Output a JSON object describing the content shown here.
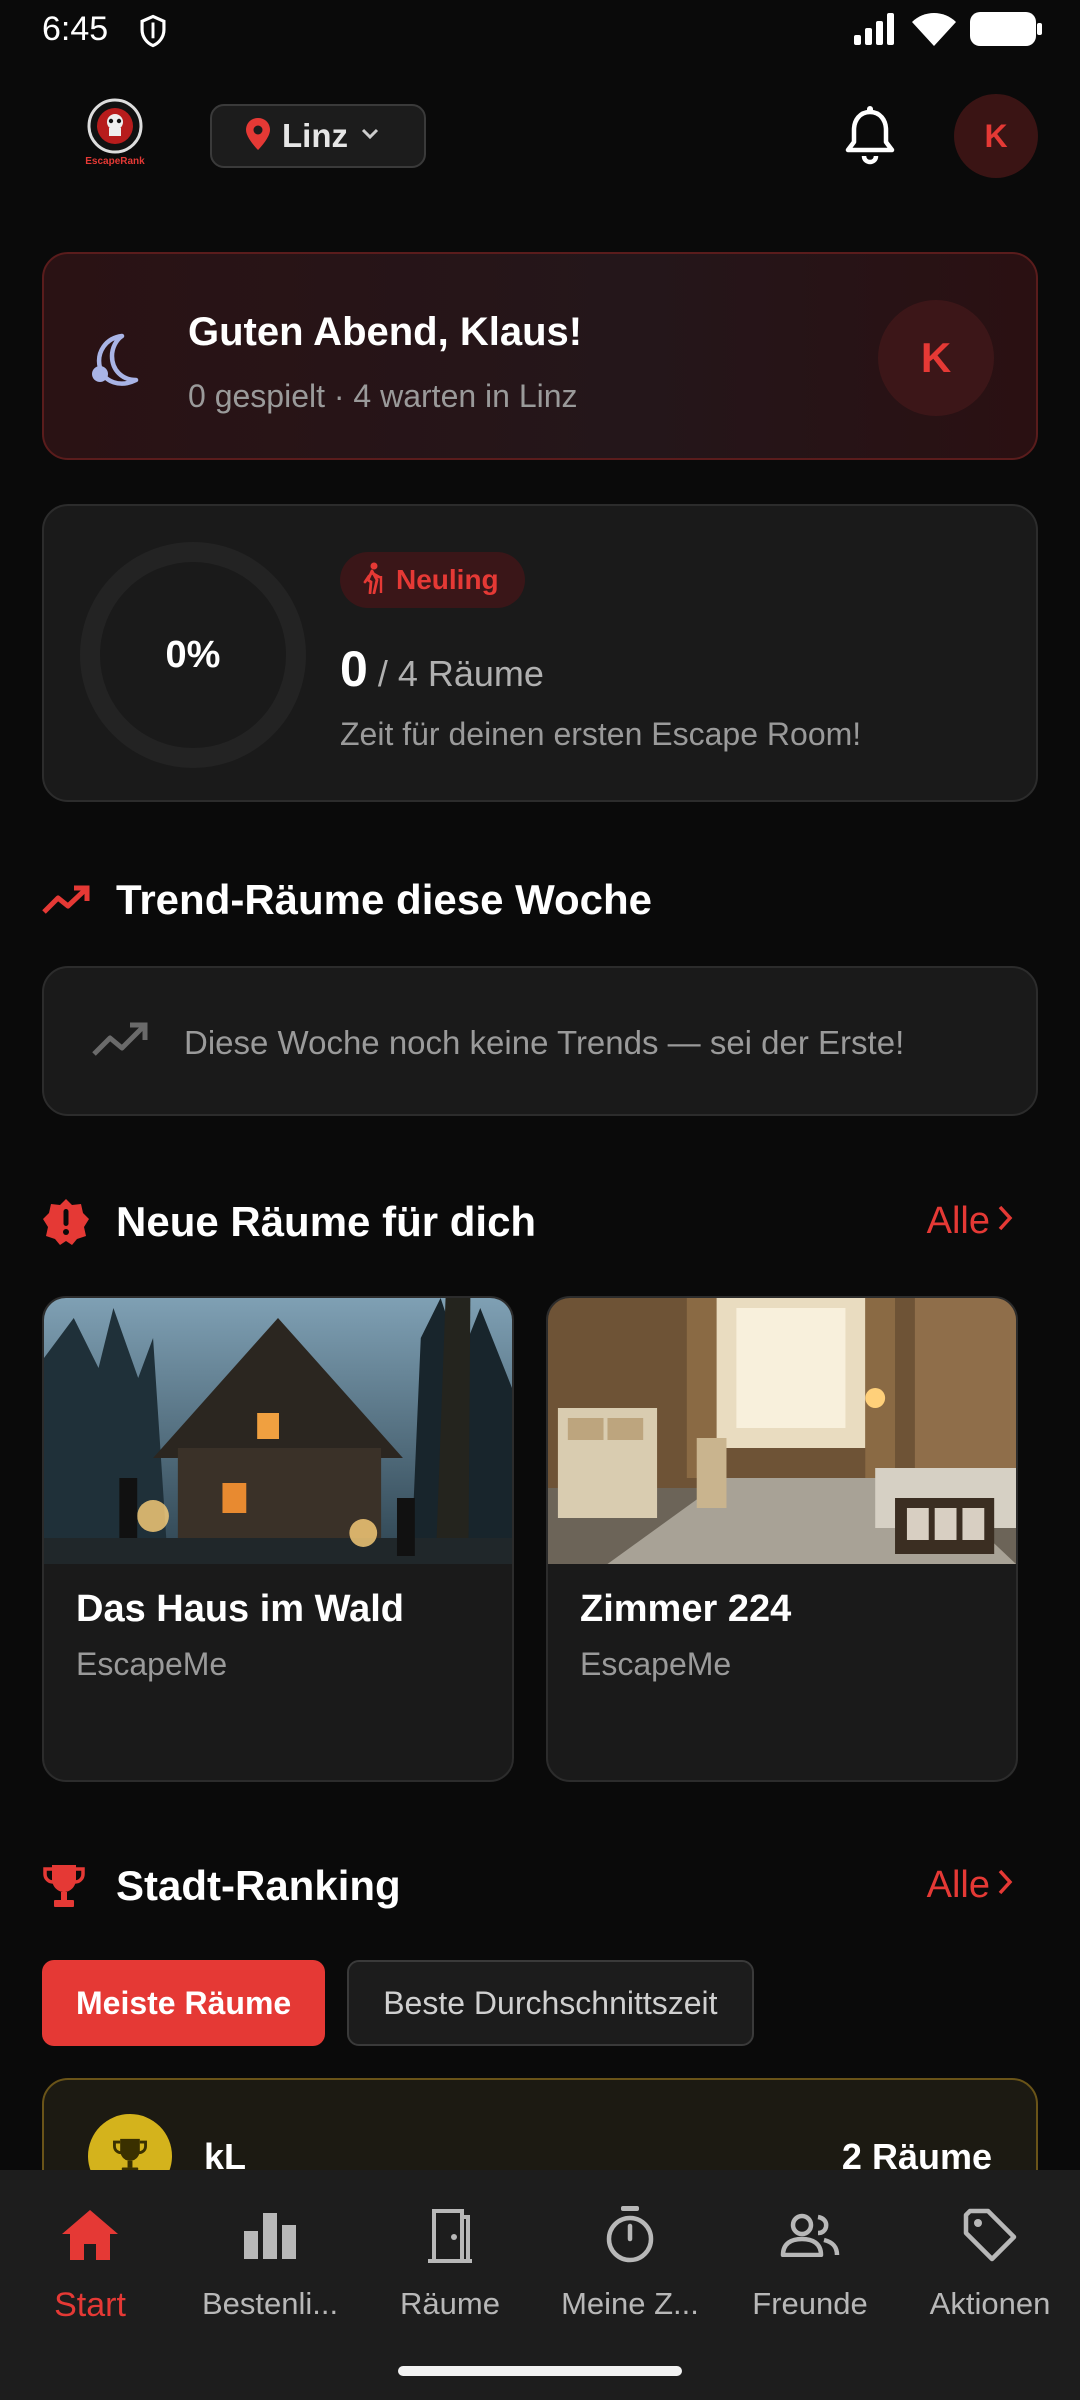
{
  "status_bar": {
    "time": "6:45"
  },
  "header": {
    "city": "Linz",
    "avatar_initial": "K",
    "logo_text": "EscapeRank"
  },
  "greeting": {
    "title": "Guten Abend, Klaus!",
    "subtitle": "0 gespielt · 4 warten in Linz",
    "avatar_initial": "K"
  },
  "progress": {
    "percent_label": "0%",
    "percent": 0,
    "badge": "Neuling",
    "played": "0",
    "total_label": "/ 4 Räume",
    "message": "Zeit für deinen ersten Escape Room!"
  },
  "trends": {
    "title": "Trend-Räume diese Woche",
    "empty_text": "Diese Woche noch keine Trends — sei der Erste!"
  },
  "new_rooms": {
    "title": "Neue Räume für dich",
    "link_label": "Alle",
    "rooms": [
      {
        "name": "Das Haus im Wald",
        "company": "EscapeMe"
      },
      {
        "name": "Zimmer 224",
        "company": "EscapeMe"
      }
    ]
  },
  "ranking": {
    "title": "Stadt-Ranking",
    "link_label": "Alle",
    "filters": [
      "Meiste Räume",
      "Beste Durchschnittszeit"
    ],
    "active_filter": "Meiste Räume",
    "entries": [
      {
        "name": "kL",
        "value": "2 Räume"
      }
    ]
  },
  "bottom_nav": {
    "items": [
      {
        "label": "Start",
        "icon": "home-icon",
        "active": true
      },
      {
        "label": "Bestenli...",
        "icon": "bar-chart-icon",
        "active": false
      },
      {
        "label": "Räume",
        "icon": "door-icon",
        "active": false
      },
      {
        "label": "Meine Z...",
        "icon": "timer-icon",
        "active": false
      },
      {
        "label": "Freunde",
        "icon": "people-icon",
        "active": false
      },
      {
        "label": "Aktionen",
        "icon": "tag-icon",
        "active": false
      }
    ]
  },
  "colors": {
    "accent": "#e53935",
    "background": "#0a0a0a",
    "card": "#1a1a1a",
    "gold": "#d4b31c"
  }
}
